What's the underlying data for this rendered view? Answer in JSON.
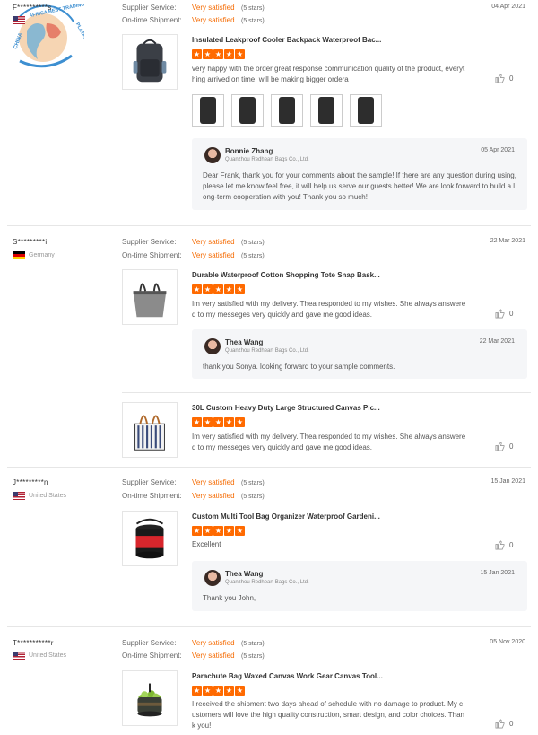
{
  "watermark": {
    "text": "CHINA AFRICA BEST TRADING PLATFORM"
  },
  "labels": {
    "supplier_service": "Supplier Service:",
    "ontime_shipment": "On-time Shipment:"
  },
  "reviews": [
    {
      "buyer": "F**********s",
      "country": "",
      "flag": "us",
      "supplier_service": "Very satisfied",
      "supplier_stars": "(5 stars)",
      "ontime": "Very satisfied",
      "ontime_stars": "(5 stars)",
      "date": "04 Apr 2021",
      "items": [
        {
          "product": "Insulated Leakproof Cooler Backpack Waterproof Bac...",
          "rating": 5,
          "text": "very happy with the order great response communication quality of the product, everything arrived on time, will be making bigger ordera",
          "likes": "0",
          "photo_count": 5,
          "reply": {
            "name": "Bonnie Zhang",
            "company": "Quanzhou Redheart Bags Co., Ltd.",
            "date": "05 Apr 2021",
            "text": "Dear Frank, thank you for your comments about the sample! If there are any question during using, please let me know feel free, it will help us serve our guests better! We are look forward to build a long-term cooperation with you! Thank you so much!"
          }
        }
      ]
    },
    {
      "buyer": "S*********i",
      "country": "Germany",
      "flag": "de",
      "supplier_service": "Very satisfied",
      "supplier_stars": "(5 stars)",
      "ontime": "Very satisfied",
      "ontime_stars": "(5 stars)",
      "date": "22 Mar 2021",
      "items": [
        {
          "product": "Durable Waterproof Cotton Shopping Tote Snap Bask...",
          "rating": 5,
          "text": "Im very satisfied with my delivery. Thea responded to my wishes. She always answered to my messeges very quickly and gave me good ideas.",
          "likes": "0",
          "reply": {
            "name": "Thea Wang",
            "company": "Quanzhou Redheart Bags Co., Ltd.",
            "date": "22 Mar 2021",
            "text": "thank you Sonya. looking forward to your sample comments."
          }
        },
        {
          "product": "30L Custom Heavy Duty Large Structured Canvas Pic...",
          "rating": 5,
          "text": "Im very satisfied with my delivery. Thea responded to my wishes. She always answered to my messeges very quickly and gave me good ideas.",
          "likes": "0"
        }
      ]
    },
    {
      "buyer": "J*********n",
      "country": "United States",
      "flag": "us",
      "supplier_service": "Very satisfied",
      "supplier_stars": "(5 stars)",
      "ontime": "Very satisfied",
      "ontime_stars": "(5 stars)",
      "date": "15 Jan 2021",
      "items": [
        {
          "product": "Custom Multi Tool Bag Organizer Waterproof Gardeni...",
          "rating": 5,
          "text": "Excellent",
          "likes": "0",
          "reply": {
            "name": "Thea Wang",
            "company": "Quanzhou Redheart Bags Co., Ltd.",
            "date": "15 Jan 2021",
            "text": "Thank you John,"
          }
        }
      ]
    },
    {
      "buyer": "T***********r",
      "country": "United States",
      "flag": "us",
      "supplier_service": "Very satisfied",
      "supplier_stars": "(5 stars)",
      "ontime": "Very satisfied",
      "ontime_stars": "(5 stars)",
      "date": "05 Nov 2020",
      "items": [
        {
          "product": "Parachute Bag Waxed Canvas Work Gear Canvas Tool...",
          "rating": 5,
          "text": "I received the shipment two days ahead of schedule with no damage to product. My customers will love the high quality construction, smart design, and color choices. Thank you!",
          "likes": "0"
        }
      ]
    }
  ]
}
